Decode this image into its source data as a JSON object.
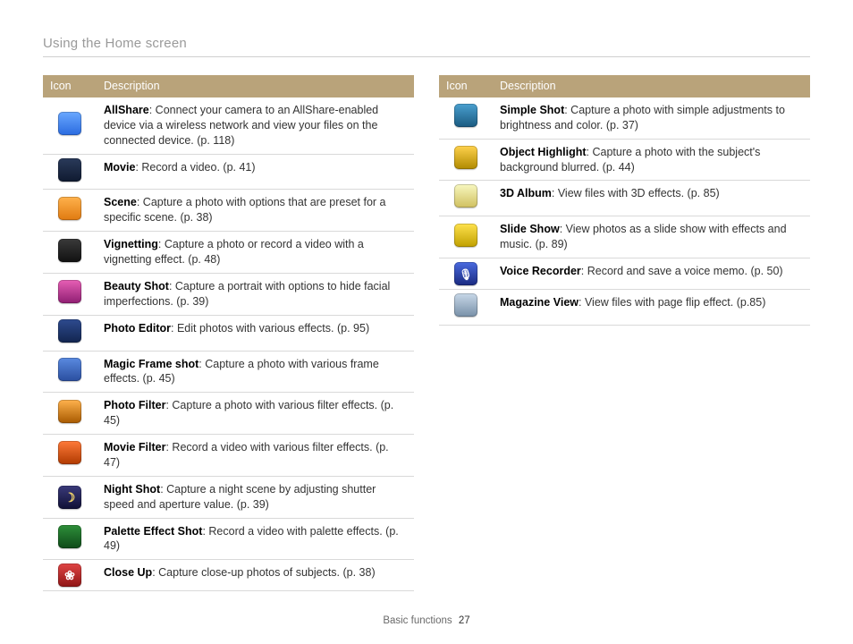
{
  "page_title": "Using the Home screen",
  "footer": {
    "section": "Basic functions",
    "page": "27"
  },
  "table_headers": {
    "icon": "Icon",
    "description": "Description"
  },
  "left_rows": [
    {
      "name": "AllShare",
      "desc": ": Connect your camera to an AllShare-enabled device via a wireless network and view your files on the connected device. (p. 118)",
      "icon": "ico-allshare"
    },
    {
      "name": "Movie",
      "desc": ": Record a video. (p. 41)",
      "icon": "ico-movie"
    },
    {
      "name": "Scene",
      "desc": ": Capture a photo with options that are preset for a specific scene. (p. 38)",
      "icon": "ico-scene"
    },
    {
      "name": "Vignetting",
      "desc": ": Capture a photo or record a video with a vignetting effect. (p. 48)",
      "icon": "ico-vignetting"
    },
    {
      "name": "Beauty Shot",
      "desc": ": Capture a portrait with options to hide facial imperfections. (p. 39)",
      "icon": "ico-beauty"
    },
    {
      "name": "Photo Editor",
      "desc": ": Edit photos with various effects. (p. 95)",
      "icon": "ico-photoeditor"
    },
    {
      "name": "Magic Frame shot",
      "desc": ": Capture a photo with various frame effects. (p. 45)",
      "icon": "ico-magicframe"
    },
    {
      "name": "Photo Filter",
      "desc": ": Capture a photo with various filter effects. (p. 45)",
      "icon": "ico-photofilter"
    },
    {
      "name": "Movie Filter",
      "desc": ": Record a video with various filter effects. (p. 47)",
      "icon": "ico-moviefilter"
    },
    {
      "name": "Night Shot",
      "desc": ": Capture a night scene by adjusting shutter speed and aperture value. (p. 39)",
      "icon": "ico-nightshot"
    },
    {
      "name": "Palette Effect Shot",
      "desc": ": Record a video with palette effects. (p. 49)",
      "icon": "ico-palette"
    },
    {
      "name": "Close Up",
      "desc": ": Capture close-up photos of subjects. (p. 38)",
      "icon": "ico-closeup"
    }
  ],
  "right_rows": [
    {
      "name": "Simple Shot",
      "desc": ": Capture a photo with simple adjustments to brightness and color. (p. 37)",
      "icon": "ico-simpleshot"
    },
    {
      "name": "Object Highlight",
      "desc": ": Capture a photo with the subject's background blurred. (p. 44)",
      "icon": "ico-objecthl"
    },
    {
      "name": "3D Album",
      "desc": ": View files with 3D effects. (p. 85)",
      "icon": "ico-3dalbum"
    },
    {
      "name": "Slide Show",
      "desc": ": View photos as a slide show with effects and music. (p. 89)",
      "icon": "ico-slideshow"
    },
    {
      "name": "Voice Recorder",
      "desc": ": Record and save a voice memo. (p. 50)",
      "icon": "ico-voicerec"
    },
    {
      "name": "Magazine View",
      "desc": ": View files with page flip effect. (p.85)",
      "icon": "ico-magview"
    }
  ]
}
